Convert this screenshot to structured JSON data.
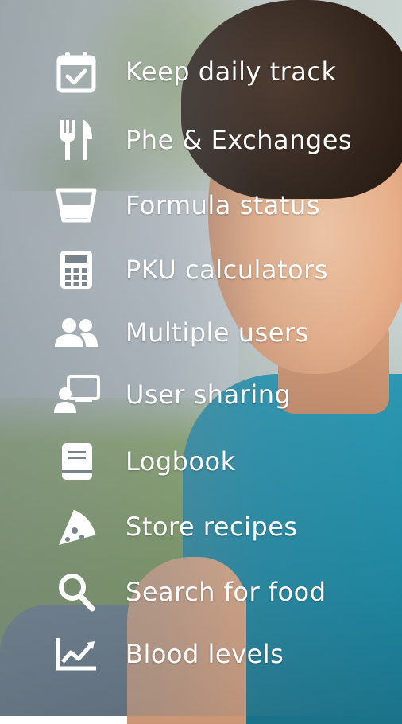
{
  "menu": {
    "items": [
      {
        "label": "Keep daily track",
        "icon": "calendar-check-icon"
      },
      {
        "label": "Phe & Exchanges",
        "icon": "fork-knife-icon"
      },
      {
        "label": "Formula status",
        "icon": "cup-icon"
      },
      {
        "label": "PKU calculators",
        "icon": "calculator-icon"
      },
      {
        "label": "Multiple users",
        "icon": "users-icon"
      },
      {
        "label": "User sharing",
        "icon": "user-sharing-icon"
      },
      {
        "label": "Logbook",
        "icon": "book-icon"
      },
      {
        "label": "Store recipes",
        "icon": "pizza-icon"
      },
      {
        "label": "Search for food",
        "icon": "search-icon"
      },
      {
        "label": "Blood levels",
        "icon": "chart-icon"
      }
    ]
  }
}
